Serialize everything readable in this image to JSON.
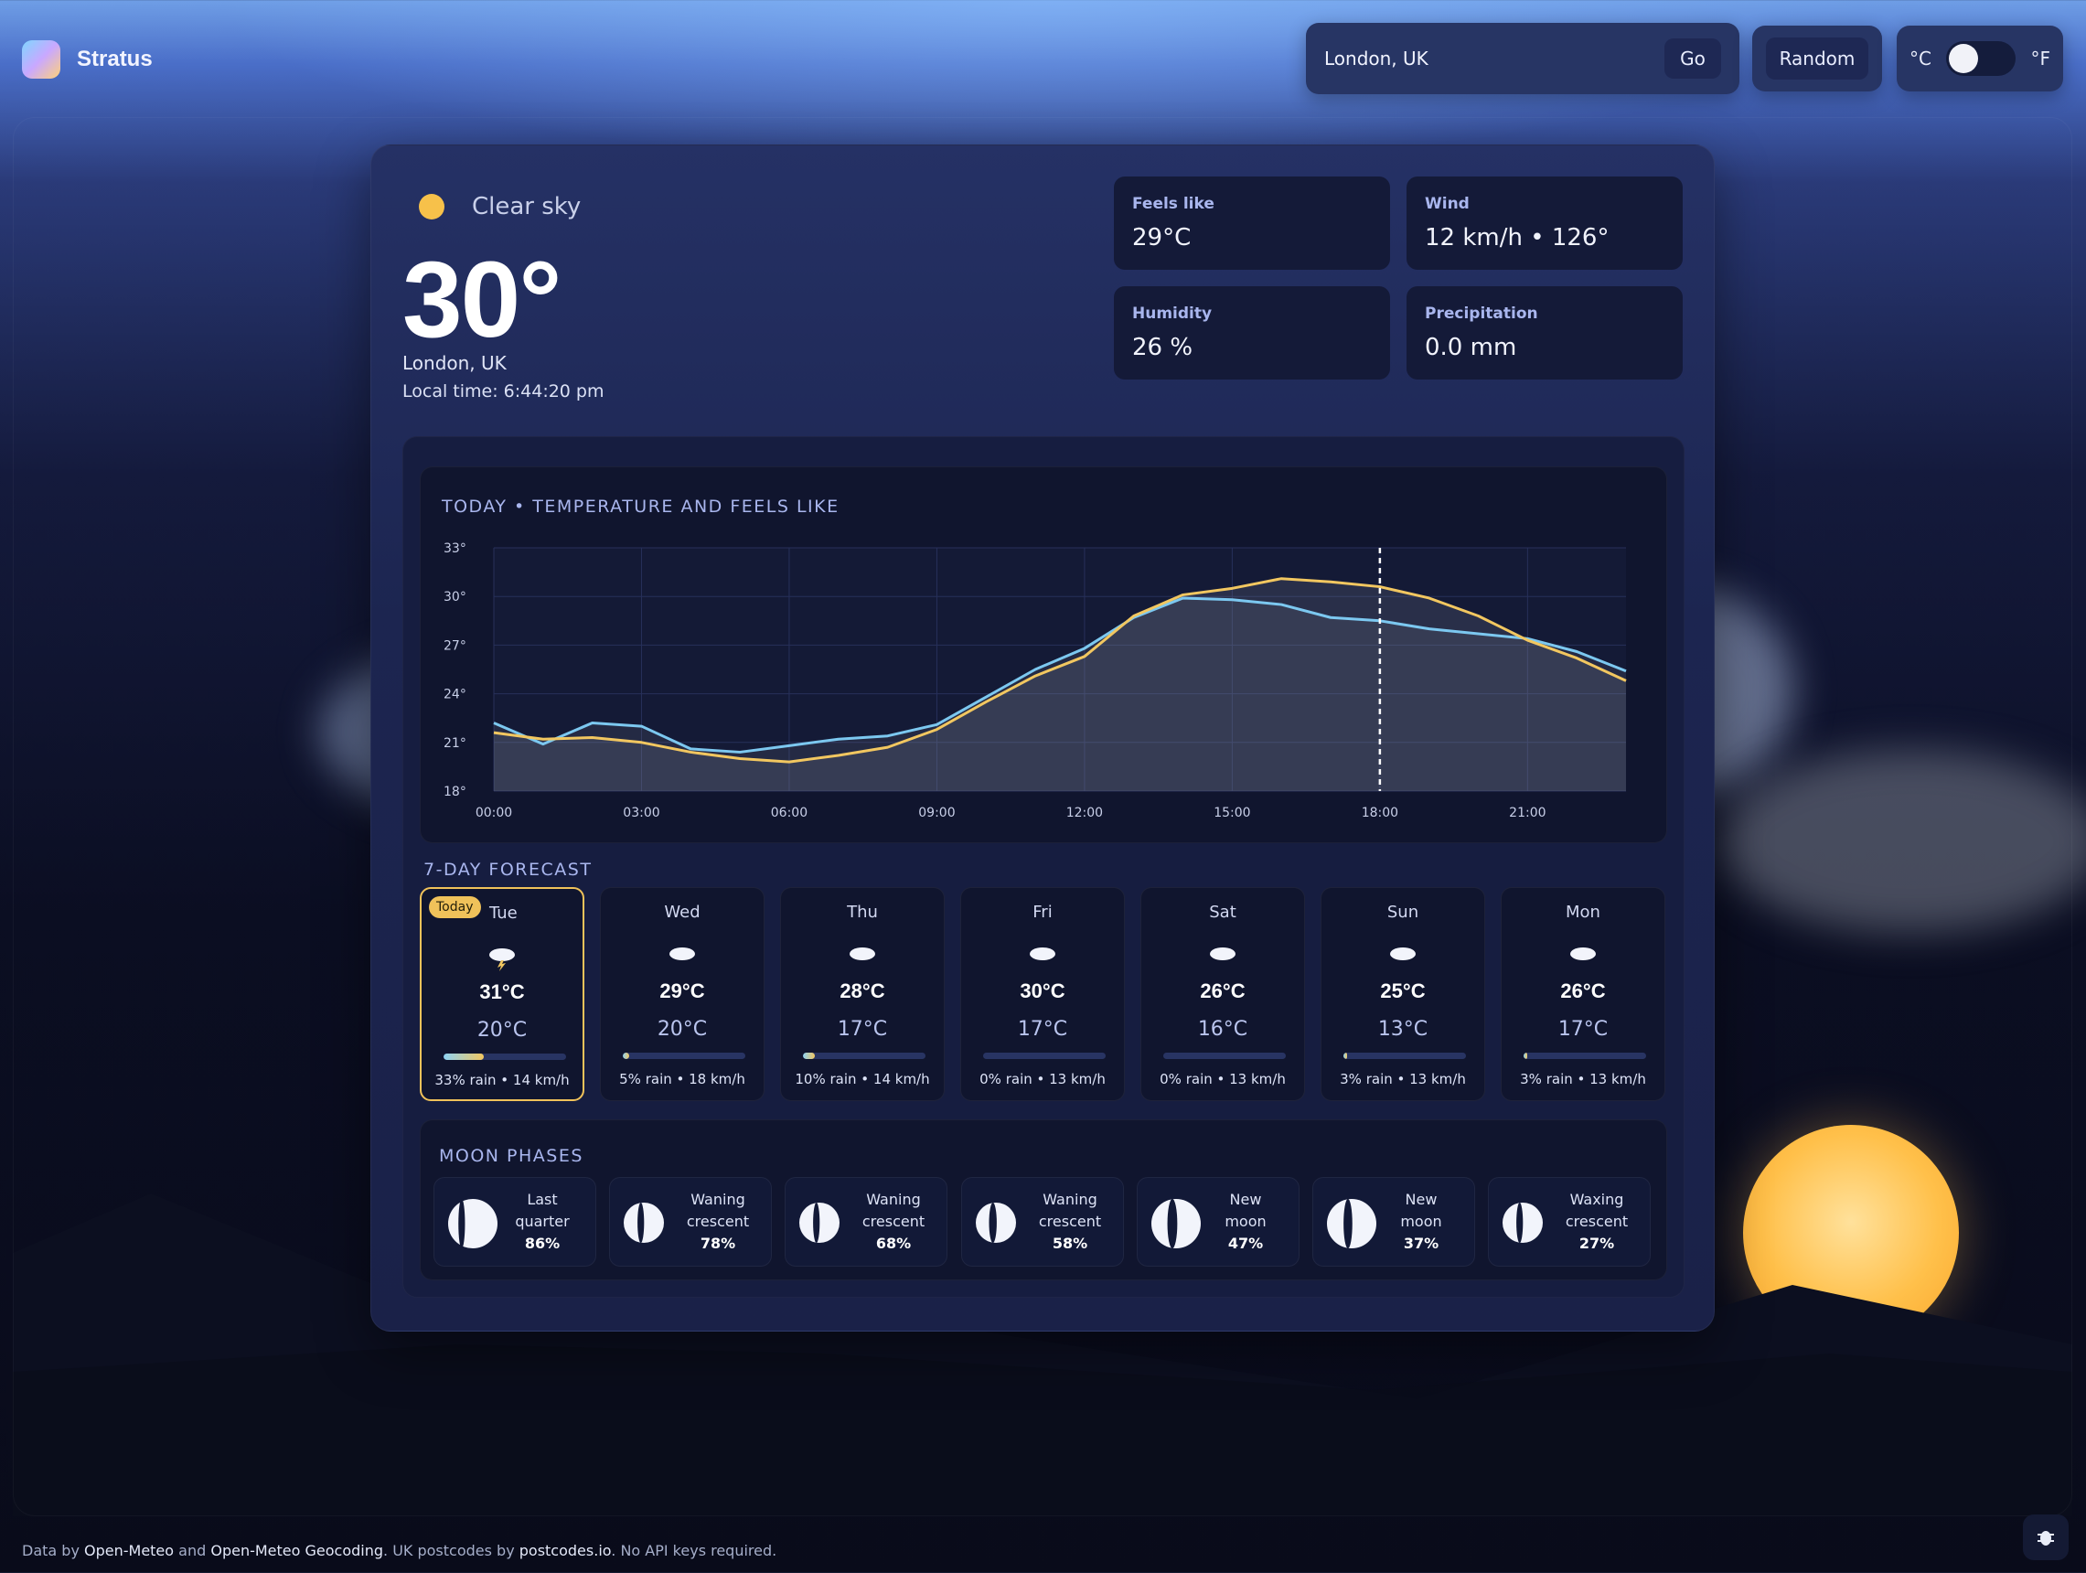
{
  "app": {
    "name": "Stratus"
  },
  "topbar": {
    "search_value": "London, UK",
    "go_label": "Go",
    "random_label": "Random",
    "unit_c": "°C",
    "unit_f": "°F",
    "unit_selected": "°C"
  },
  "current": {
    "condition": "Clear sky",
    "temperature": "30°",
    "location": "London, UK",
    "local_time": "Local time: 6:44:20 pm"
  },
  "stats": {
    "feels_like": {
      "label": "Feels like",
      "value": "29°C"
    },
    "wind": {
      "label": "Wind",
      "value": "12 km/h • 126°"
    },
    "humidity": {
      "label": "Humidity",
      "value": "26 %"
    },
    "precipitation": {
      "label": "Precipitation",
      "value": "0.0 mm"
    }
  },
  "chart_data": {
    "type": "line",
    "title": "TODAY • TEMPERATURE AND FEELS LIKE",
    "x_unit": "hour",
    "x": [
      0,
      1,
      2,
      3,
      4,
      5,
      6,
      7,
      8,
      9,
      10,
      11,
      12,
      13,
      14,
      15,
      16,
      17,
      18,
      19,
      20,
      21,
      22,
      23
    ],
    "x_ticks": [
      "00:00",
      "03:00",
      "06:00",
      "09:00",
      "12:00",
      "15:00",
      "18:00",
      "21:00"
    ],
    "y_ticks": [
      "33°",
      "30°",
      "27°",
      "24°",
      "21°",
      "18°"
    ],
    "ylim": [
      18,
      33
    ],
    "current_time_marker_hour": 18,
    "series": [
      {
        "color": "#7cc8f0",
        "values": [
          22.2,
          20.9,
          22.2,
          22.0,
          20.6,
          20.4,
          20.8,
          21.2,
          21.4,
          22.1,
          23.8,
          25.5,
          26.8,
          28.7,
          29.9,
          29.8,
          29.5,
          28.7,
          28.5,
          28.0,
          27.7,
          27.4,
          26.6,
          25.4
        ]
      },
      {
        "color": "#f2c760",
        "values": [
          21.6,
          21.2,
          21.3,
          21.0,
          20.4,
          20.0,
          19.8,
          20.2,
          20.7,
          21.8,
          23.5,
          25.1,
          26.3,
          28.8,
          30.1,
          30.5,
          31.1,
          30.9,
          30.6,
          29.9,
          28.8,
          27.3,
          26.2,
          24.8
        ]
      }
    ]
  },
  "forecast": {
    "title": "7-DAY FORECAST",
    "today_badge": "Today",
    "days": [
      {
        "name": "Tue",
        "hi": "31°C",
        "lo": "20°C",
        "rain_pct": 33,
        "meta": "33% rain • 14 km/h",
        "icon": "thunder-cloud-icon"
      },
      {
        "name": "Wed",
        "hi": "29°C",
        "lo": "20°C",
        "rain_pct": 5,
        "meta": "5% rain • 18 km/h",
        "icon": "cloud-icon"
      },
      {
        "name": "Thu",
        "hi": "28°C",
        "lo": "17°C",
        "rain_pct": 10,
        "meta": "10% rain • 14 km/h",
        "icon": "cloud-icon"
      },
      {
        "name": "Fri",
        "hi": "30°C",
        "lo": "17°C",
        "rain_pct": 0,
        "meta": "0% rain • 13 km/h",
        "icon": "cloud-icon"
      },
      {
        "name": "Sat",
        "hi": "26°C",
        "lo": "16°C",
        "rain_pct": 0,
        "meta": "0% rain • 13 km/h",
        "icon": "cloud-icon"
      },
      {
        "name": "Sun",
        "hi": "25°C",
        "lo": "13°C",
        "rain_pct": 3,
        "meta": "3% rain • 13 km/h",
        "icon": "cloud-icon"
      },
      {
        "name": "Mon",
        "hi": "26°C",
        "lo": "17°C",
        "rain_pct": 3,
        "meta": "3% rain • 13 km/h",
        "icon": "cloud-icon"
      }
    ]
  },
  "moon": {
    "title": "MOON PHASES",
    "phases": [
      {
        "line1": "Last",
        "line2": "quarter",
        "pct": "86%",
        "lit": 0.86
      },
      {
        "line1": "Waning",
        "line2": "crescent",
        "pct": "78%",
        "lit": 0.78
      },
      {
        "line1": "Waning",
        "line2": "crescent",
        "pct": "68%",
        "lit": 0.68
      },
      {
        "line1": "Waning",
        "line2": "crescent",
        "pct": "58%",
        "lit": 0.58
      },
      {
        "line1": "New",
        "line2": "moon",
        "pct": "47%",
        "lit": 0.47
      },
      {
        "line1": "New",
        "line2": "moon",
        "pct": "37%",
        "lit": 0.37
      },
      {
        "line1": "Waxing",
        "line2": "crescent",
        "pct": "27%",
        "lit": 0.27
      }
    ]
  },
  "footer": {
    "t1": "Data by ",
    "link1": "Open-Meteo",
    "t2": " and ",
    "link2": "Open-Meteo Geocoding",
    "t3": ". UK postcodes by ",
    "link3": "postcodes.io",
    "t4": ". No API keys required."
  },
  "colors": {
    "accent": "#f0c25a",
    "temp_line": "#7cc8f0",
    "feels_line": "#f2c760",
    "sun": "#ffc04a"
  }
}
